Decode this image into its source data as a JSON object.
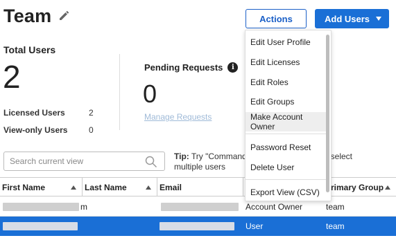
{
  "page": {
    "title": "Team"
  },
  "header": {
    "actions_label": "Actions",
    "add_users_label": "Add Users"
  },
  "stats": {
    "total_title": "Total Users",
    "total_count": "2",
    "licensed_label": "Licensed Users",
    "licensed_value": "2",
    "viewonly_label": "View-only Users",
    "viewonly_value": "0",
    "pending_title": "Pending Requests",
    "pending_count": "0",
    "manage_link": "Manage Requests"
  },
  "search": {
    "placeholder": "Search current view"
  },
  "tip": {
    "label": "Tip:",
    "text_start": "Try \"Command",
    "text_end": "\" to select",
    "text_line2": "multiple users"
  },
  "table": {
    "columns": [
      "First Name",
      "Last Name",
      "Email",
      "Primary Group"
    ],
    "rows": [
      {
        "first_name_tail": "m",
        "last_name": "",
        "role_col": "Account Owner",
        "group": "team"
      },
      {
        "first_name_tail": "",
        "last_name": "",
        "role_col": "User",
        "group": "team"
      }
    ]
  },
  "actions_menu": {
    "items": [
      "Edit User Profile",
      "Edit Licenses",
      "Edit Roles",
      "Edit Groups",
      "Make Account Owner",
      "Password Reset",
      "Delete User",
      "Export View (CSV)"
    ],
    "hovered": "Make Account Owner"
  },
  "colors": {
    "primary": "#1a6fd6",
    "selected_row": "#1a6fd6",
    "link_muted": "#9fbad8"
  }
}
